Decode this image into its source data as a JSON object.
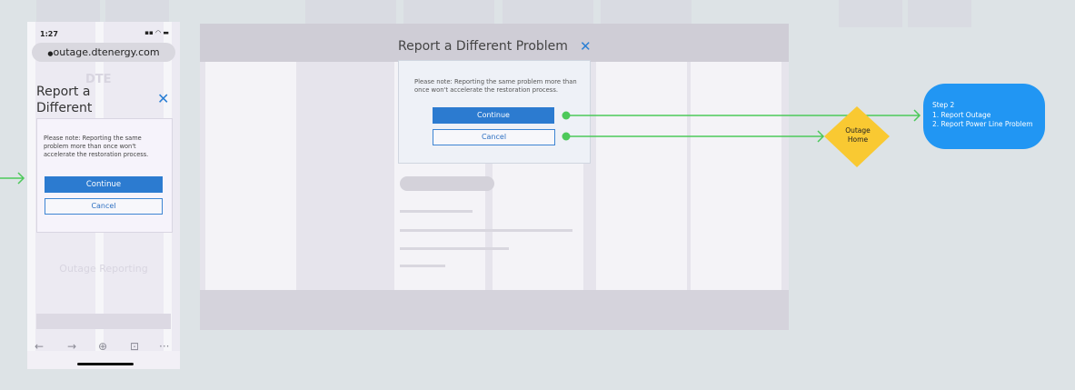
{
  "phone": {
    "time": "1:27",
    "url": "outage.dtenergy.com",
    "dialog_title": "Report a Different Problem",
    "note": "Please note: Reporting the same problem more than once won't accelerate the restoration process.",
    "continue_label": "Continue",
    "cancel_label": "Cancel",
    "faded_heading": "Outage Reporting"
  },
  "desktop": {
    "dialog_title": "Report a Different Problem",
    "note": "Please note: Reporting the same problem more than once won't accelerate the restoration process.",
    "continue_label": "Continue",
    "cancel_label": "Cancel"
  },
  "flow": {
    "decision_label": "Outage Home",
    "step": {
      "title": "Step 2",
      "items": [
        "1. Report Outage",
        "2. Report Power Line Problem"
      ]
    }
  },
  "colors": {
    "canvas": "#dde3e6",
    "primary_button": "#2c7bd0",
    "connector": "#4cc95a",
    "decision": "#f9c932",
    "step": "#2196f3"
  },
  "icons": [
    "lock-icon",
    "signal-icon",
    "wifi-icon",
    "battery-icon",
    "close-icon",
    "back-arrow-icon",
    "forward-arrow-icon",
    "add-icon",
    "tabs-icon",
    "more-icon",
    "arrow-icon"
  ]
}
